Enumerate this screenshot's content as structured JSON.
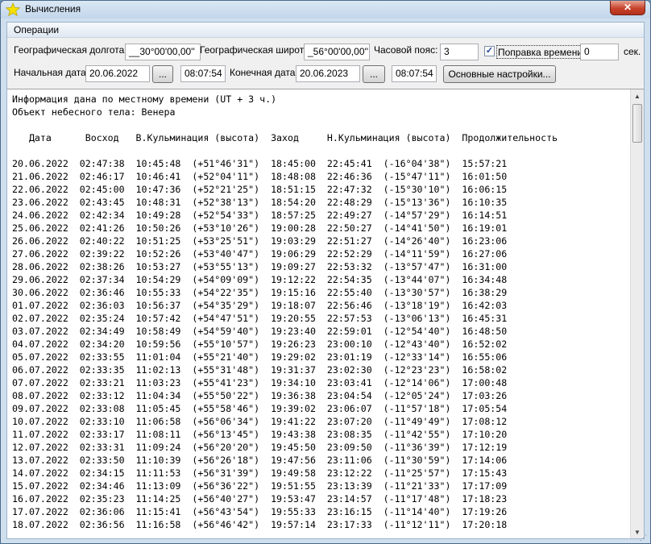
{
  "window": {
    "title": "Вычисления",
    "close_symbol": "✕"
  },
  "menu": {
    "operations": "Операции"
  },
  "params": {
    "longitude_label": "Географическая долгота:",
    "longitude_value": "__30°00'00,00''",
    "latitude_label": "Географическая широта:",
    "latitude_value": "_56°00'00,00''",
    "timezone_label": "Часовой пояс:",
    "timezone_value": "3",
    "time_correction_label": "Поправка времени",
    "time_correction_checked": "✓",
    "time_correction_value": "0",
    "sec_label": "сек.",
    "start_date_label": "Начальная дата:",
    "start_date_value": "20.06.2022",
    "start_time_value": "08:07:54",
    "end_date_label": "Конечная дата:",
    "end_date_value": "20.06.2023",
    "end_time_value": "08:07:54",
    "browse_label": "...",
    "settings_button": "Основные настройки..."
  },
  "output": {
    "lines": [
      "Информация дана по местному времени (UT + 3 ч.)",
      "Объект небесного тела: Венера",
      "",
      "   Дата      Восход   В.Кульминация (высота)  Заход     Н.Кульминация (высота)  Продолжительность",
      "",
      "20.06.2022  02:47:38  10:45:48  (+51°46'31\")  18:45:00  22:45:41  (-16°04'38\")  15:57:21",
      "21.06.2022  02:46:17  10:46:41  (+52°04'11\")  18:48:08  22:46:36  (-15°47'11\")  16:01:50",
      "22.06.2022  02:45:00  10:47:36  (+52°21'25\")  18:51:15  22:47:32  (-15°30'10\")  16:06:15",
      "23.06.2022  02:43:45  10:48:31  (+52°38'13\")  18:54:20  22:48:29  (-15°13'36\")  16:10:35",
      "24.06.2022  02:42:34  10:49:28  (+52°54'33\")  18:57:25  22:49:27  (-14°57'29\")  16:14:51",
      "25.06.2022  02:41:26  10:50:26  (+53°10'26\")  19:00:28  22:50:27  (-14°41'50\")  16:19:01",
      "26.06.2022  02:40:22  10:51:25  (+53°25'51\")  19:03:29  22:51:27  (-14°26'40\")  16:23:06",
      "27.06.2022  02:39:22  10:52:26  (+53°40'47\")  19:06:29  22:52:29  (-14°11'59\")  16:27:06",
      "28.06.2022  02:38:26  10:53:27  (+53°55'13\")  19:09:27  22:53:32  (-13°57'47\")  16:31:00",
      "29.06.2022  02:37:34  10:54:29  (+54°09'09\")  19:12:22  22:54:35  (-13°44'07\")  16:34:48",
      "30.06.2022  02:36:46  10:55:33  (+54°22'35\")  19:15:16  22:55:40  (-13°30'57\")  16:38:29",
      "01.07.2022  02:36:03  10:56:37  (+54°35'29\")  19:18:07  22:56:46  (-13°18'19\")  16:42:03",
      "02.07.2022  02:35:24  10:57:42  (+54°47'51\")  19:20:55  22:57:53  (-13°06'13\")  16:45:31",
      "03.07.2022  02:34:49  10:58:49  (+54°59'40\")  19:23:40  22:59:01  (-12°54'40\")  16:48:50",
      "04.07.2022  02:34:20  10:59:56  (+55°10'57\")  19:26:23  23:00:10  (-12°43'40\")  16:52:02",
      "05.07.2022  02:33:55  11:01:04  (+55°21'40\")  19:29:02  23:01:19  (-12°33'14\")  16:55:06",
      "06.07.2022  02:33:35  11:02:13  (+55°31'48\")  19:31:37  23:02:30  (-12°23'23\")  16:58:02",
      "07.07.2022  02:33:21  11:03:23  (+55°41'23\")  19:34:10  23:03:41  (-12°14'06\")  17:00:48",
      "08.07.2022  02:33:12  11:04:34  (+55°50'22\")  19:36:38  23:04:54  (-12°05'24\")  17:03:26",
      "09.07.2022  02:33:08  11:05:45  (+55°58'46\")  19:39:02  23:06:07  (-11°57'18\")  17:05:54",
      "10.07.2022  02:33:10  11:06:58  (+56°06'34\")  19:41:22  23:07:20  (-11°49'49\")  17:08:12",
      "11.07.2022  02:33:17  11:08:11  (+56°13'45\")  19:43:38  23:08:35  (-11°42'55\")  17:10:20",
      "12.07.2022  02:33:31  11:09:24  (+56°20'20\")  19:45:50  23:09:50  (-11°36'39\")  17:12:19",
      "13.07.2022  02:33:50  11:10:39  (+56°26'18\")  19:47:56  23:11:06  (-11°30'59\")  17:14:06",
      "14.07.2022  02:34:15  11:11:53  (+56°31'39\")  19:49:58  23:12:22  (-11°25'57\")  17:15:43",
      "15.07.2022  02:34:46  11:13:09  (+56°36'22\")  19:51:55  23:13:39  (-11°21'33\")  17:17:09",
      "16.07.2022  02:35:23  11:14:25  (+56°40'27\")  19:53:47  23:14:57  (-11°17'48\")  17:18:23",
      "17.07.2022  02:36:06  11:15:41  (+56°43'54\")  19:55:33  23:16:15  (-11°14'40\")  17:19:26",
      "18.07.2022  02:36:56  11:16:58  (+56°46'42\")  19:57:14  23:17:33  (-11°12'11\")  17:20:18"
    ]
  },
  "icons": {
    "app": "star-icon",
    "scroll_up": "arrow-up-icon",
    "scroll_down": "arrow-down-icon"
  }
}
